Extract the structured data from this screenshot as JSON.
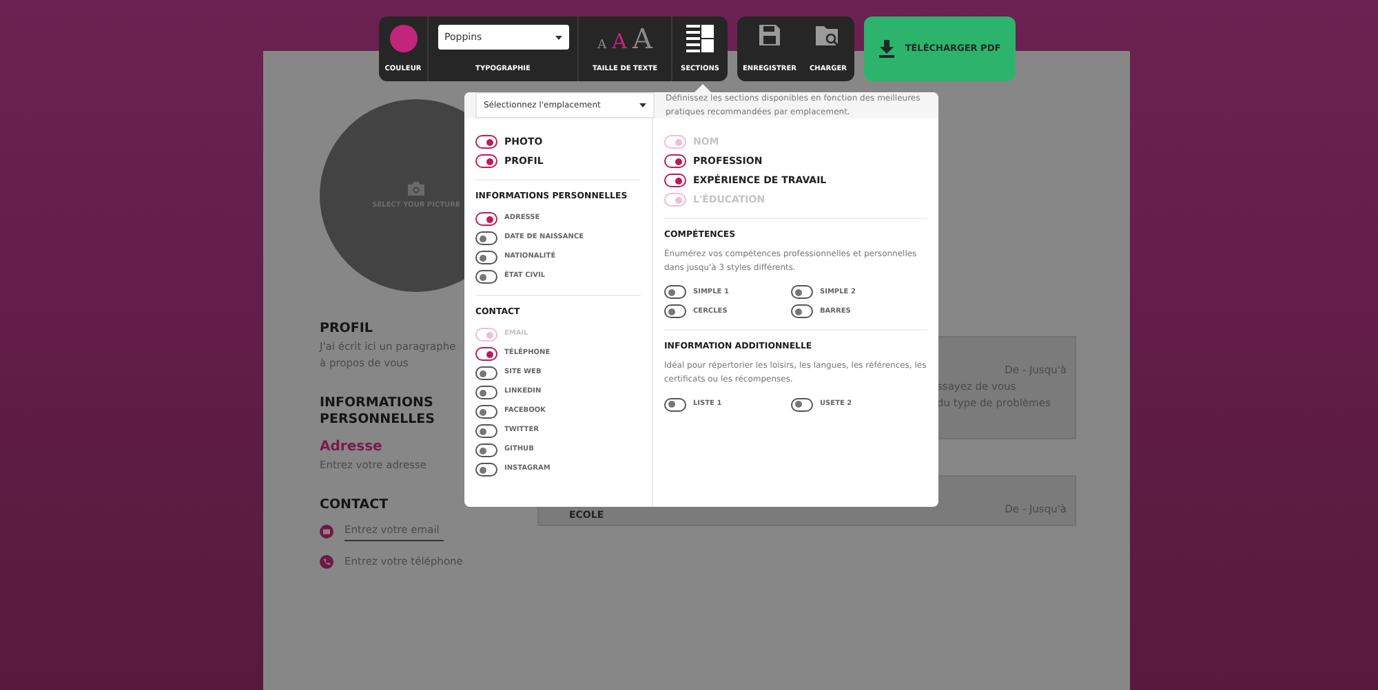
{
  "toolbar": {
    "tools": [
      {
        "kind": "color",
        "label": "COULEUR"
      },
      {
        "kind": "font",
        "label": "TYPOGRAPHIE",
        "value": "Poppins"
      },
      {
        "kind": "size",
        "label": "TAILLE DE TEXTE",
        "sizes": [
          {
            "glyph": "A",
            "selected": false
          },
          {
            "glyph": "A",
            "selected": true
          },
          {
            "glyph": "A",
            "selected": false
          }
        ]
      },
      {
        "kind": "sections",
        "label": "SECTIONS"
      }
    ],
    "file_buttons": [
      {
        "kind": "save",
        "label": "ENREGISTRER"
      },
      {
        "kind": "load",
        "label": "CHARGER"
      }
    ],
    "download_button": "TÉLÉCHARGER PDF"
  },
  "sections_panel": {
    "location_select": "Sélectionnez l'emplacement",
    "description": "Définissez les sections disponibles en fonction des meilleures pratiques recommandées par emplacement.",
    "columns": [
      [
        {
          "kind": "main",
          "toggles": [
            {
              "label": "PHOTO",
              "on": true,
              "disabled": false
            },
            {
              "label": "PROFIL",
              "on": true,
              "disabled": false
            }
          ]
        },
        {
          "kind": "list",
          "heading": "INFORMATIONS PERSONNELLES",
          "toggles": [
            {
              "label": "ADRESSE",
              "on": true,
              "disabled": false
            },
            {
              "label": "DATE DE NAISSANCE",
              "on": false,
              "disabled": false
            },
            {
              "label": "NATIONALITÉ",
              "on": false,
              "disabled": false
            },
            {
              "label": "ÉTAT CIVIL",
              "on": false,
              "disabled": false
            }
          ]
        },
        {
          "kind": "list",
          "heading": "CONTACT",
          "toggles": [
            {
              "label": "EMAIL",
              "on": true,
              "disabled": true
            },
            {
              "label": "TÉLÉPHONE",
              "on": true,
              "disabled": false
            },
            {
              "label": "SITE WEB",
              "on": false,
              "disabled": false
            },
            {
              "label": "LINKEDIN",
              "on": false,
              "disabled": false
            },
            {
              "label": "FACEBOOK",
              "on": false,
              "disabled": false
            },
            {
              "label": "TWITTER",
              "on": false,
              "disabled": false
            },
            {
              "label": "GITHUB",
              "on": false,
              "disabled": false
            },
            {
              "label": "INSTAGRAM",
              "on": false,
              "disabled": false
            }
          ]
        }
      ],
      [
        {
          "kind": "main",
          "toggles": [
            {
              "label": "NOM",
              "on": true,
              "disabled": true
            },
            {
              "label": "PROFESSION",
              "on": true,
              "disabled": false
            },
            {
              "label": "EXPÉRIENCE DE TRAVAIL",
              "on": true,
              "disabled": false
            },
            {
              "label": "L'ÉDUCATION",
              "on": true,
              "disabled": true
            }
          ]
        },
        {
          "kind": "grid",
          "heading": "COMPÉTENCES",
          "description": "Énumérez vos compétences professionnelles et personnelles dans jusqu'à 3 styles différents.",
          "toggles": [
            {
              "label": "SIMPLE 1",
              "on": false,
              "disabled": false
            },
            {
              "label": "SIMPLE 2",
              "on": false,
              "disabled": false
            },
            {
              "label": "CERCLES",
              "on": false,
              "disabled": false
            },
            {
              "label": "BARRES",
              "on": false,
              "disabled": false
            }
          ]
        },
        {
          "kind": "grid",
          "heading": "INFORMATION ADDITIONNELLE",
          "description": "Idéal pour répertorier les loisirs, les langues, les références, les certificats ou les récompenses.",
          "toggles": [
            {
              "label": "LISTE 1",
              "on": false,
              "disabled": false
            },
            {
              "label": "USETE 2",
              "on": false,
              "disabled": false
            }
          ]
        }
      ]
    ]
  },
  "resume": {
    "picture_label": "SELECT YOUR PICTURE",
    "profile": {
      "heading": "PROFIL",
      "text": "J'ai écrit ici un paragraphe à propos de vous"
    },
    "personal": {
      "heading": "INFORMATIONS PERSONNELLES",
      "field_label": "Adresse",
      "placeholder": "Entrez votre adresse"
    },
    "contact": {
      "heading": "CONTACT",
      "fields": [
        {
          "kind": "email",
          "placeholder": "Entrez votre email",
          "focused": true
        },
        {
          "kind": "phone",
          "placeholder": "Entrez votre téléphone",
          "focused": false
        }
      ]
    },
    "entries": [
      {
        "dates": "De - Jusqu'à",
        "lines": [
          "ssayez de vous",
          "du type de problèmes"
        ]
      },
      {
        "dates": "De - Jusqu'à",
        "heading": "ECOLE"
      }
    ]
  }
}
